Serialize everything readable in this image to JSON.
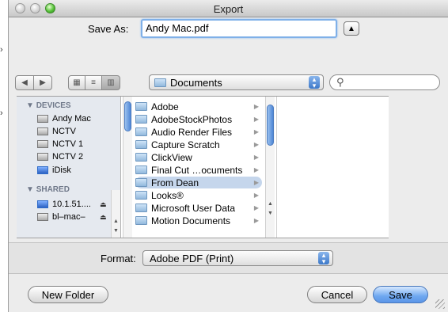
{
  "window": {
    "title": "Export"
  },
  "save_as": {
    "label": "Save As:",
    "value": "Andy Mac.pdf"
  },
  "location": {
    "current": "Documents",
    "search_placeholder": ""
  },
  "sidebar": {
    "devices_header": "DEVICES",
    "devices": [
      "Andy Mac",
      "NCTV",
      "NCTV 1",
      "NCTV 2",
      "iDisk"
    ],
    "shared_header": "SHARED",
    "shared": [
      "10.1.51....",
      "bl–mac–"
    ]
  },
  "files": [
    {
      "name": "Adobe",
      "selected": false
    },
    {
      "name": "AdobeStockPhotos",
      "selected": false
    },
    {
      "name": "Audio Render Files",
      "selected": false
    },
    {
      "name": "Capture Scratch",
      "selected": false
    },
    {
      "name": "ClickView",
      "selected": false
    },
    {
      "name": "Final Cut …ocuments",
      "selected": false
    },
    {
      "name": "From Dean",
      "selected": true
    },
    {
      "name": "Looks®",
      "selected": false
    },
    {
      "name": "Microsoft User Data",
      "selected": false
    },
    {
      "name": "Motion Documents",
      "selected": false
    }
  ],
  "format": {
    "label": "Format:",
    "value": "Adobe PDF (Print)"
  },
  "buttons": {
    "new_folder": "New Folder",
    "cancel": "Cancel",
    "save": "Save"
  },
  "colors": {
    "accent": "#5a95e8",
    "selection": "#c5d6ec",
    "sidebar_bg": "#e5e9ef"
  }
}
